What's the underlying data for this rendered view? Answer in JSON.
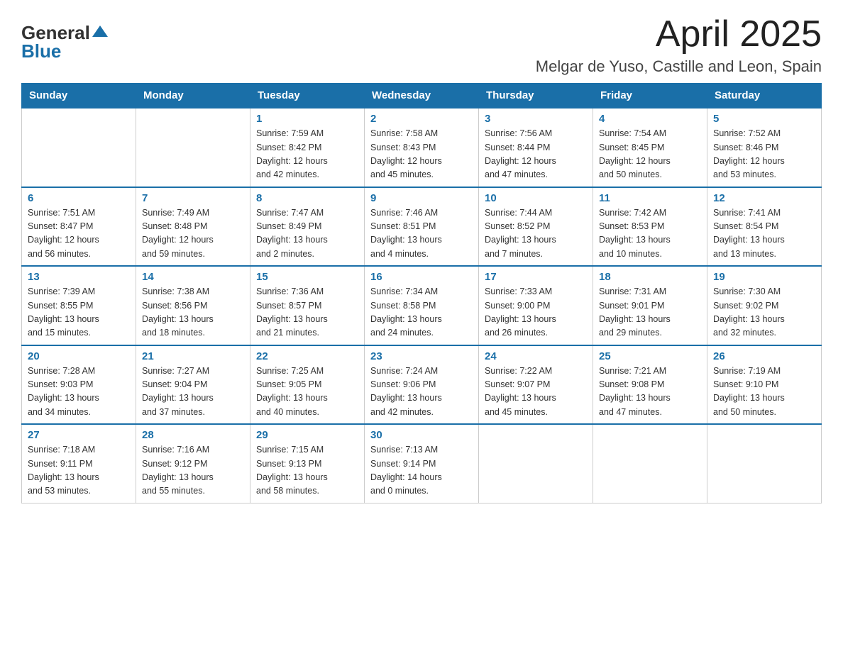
{
  "header": {
    "logo_general": "General",
    "logo_blue": "Blue",
    "title": "April 2025",
    "subtitle": "Melgar de Yuso, Castille and Leon, Spain"
  },
  "days_of_week": [
    "Sunday",
    "Monday",
    "Tuesday",
    "Wednesday",
    "Thursday",
    "Friday",
    "Saturday"
  ],
  "weeks": [
    [
      {
        "day": "",
        "info": ""
      },
      {
        "day": "",
        "info": ""
      },
      {
        "day": "1",
        "info": "Sunrise: 7:59 AM\nSunset: 8:42 PM\nDaylight: 12 hours\nand 42 minutes."
      },
      {
        "day": "2",
        "info": "Sunrise: 7:58 AM\nSunset: 8:43 PM\nDaylight: 12 hours\nand 45 minutes."
      },
      {
        "day": "3",
        "info": "Sunrise: 7:56 AM\nSunset: 8:44 PM\nDaylight: 12 hours\nand 47 minutes."
      },
      {
        "day": "4",
        "info": "Sunrise: 7:54 AM\nSunset: 8:45 PM\nDaylight: 12 hours\nand 50 minutes."
      },
      {
        "day": "5",
        "info": "Sunrise: 7:52 AM\nSunset: 8:46 PM\nDaylight: 12 hours\nand 53 minutes."
      }
    ],
    [
      {
        "day": "6",
        "info": "Sunrise: 7:51 AM\nSunset: 8:47 PM\nDaylight: 12 hours\nand 56 minutes."
      },
      {
        "day": "7",
        "info": "Sunrise: 7:49 AM\nSunset: 8:48 PM\nDaylight: 12 hours\nand 59 minutes."
      },
      {
        "day": "8",
        "info": "Sunrise: 7:47 AM\nSunset: 8:49 PM\nDaylight: 13 hours\nand 2 minutes."
      },
      {
        "day": "9",
        "info": "Sunrise: 7:46 AM\nSunset: 8:51 PM\nDaylight: 13 hours\nand 4 minutes."
      },
      {
        "day": "10",
        "info": "Sunrise: 7:44 AM\nSunset: 8:52 PM\nDaylight: 13 hours\nand 7 minutes."
      },
      {
        "day": "11",
        "info": "Sunrise: 7:42 AM\nSunset: 8:53 PM\nDaylight: 13 hours\nand 10 minutes."
      },
      {
        "day": "12",
        "info": "Sunrise: 7:41 AM\nSunset: 8:54 PM\nDaylight: 13 hours\nand 13 minutes."
      }
    ],
    [
      {
        "day": "13",
        "info": "Sunrise: 7:39 AM\nSunset: 8:55 PM\nDaylight: 13 hours\nand 15 minutes."
      },
      {
        "day": "14",
        "info": "Sunrise: 7:38 AM\nSunset: 8:56 PM\nDaylight: 13 hours\nand 18 minutes."
      },
      {
        "day": "15",
        "info": "Sunrise: 7:36 AM\nSunset: 8:57 PM\nDaylight: 13 hours\nand 21 minutes."
      },
      {
        "day": "16",
        "info": "Sunrise: 7:34 AM\nSunset: 8:58 PM\nDaylight: 13 hours\nand 24 minutes."
      },
      {
        "day": "17",
        "info": "Sunrise: 7:33 AM\nSunset: 9:00 PM\nDaylight: 13 hours\nand 26 minutes."
      },
      {
        "day": "18",
        "info": "Sunrise: 7:31 AM\nSunset: 9:01 PM\nDaylight: 13 hours\nand 29 minutes."
      },
      {
        "day": "19",
        "info": "Sunrise: 7:30 AM\nSunset: 9:02 PM\nDaylight: 13 hours\nand 32 minutes."
      }
    ],
    [
      {
        "day": "20",
        "info": "Sunrise: 7:28 AM\nSunset: 9:03 PM\nDaylight: 13 hours\nand 34 minutes."
      },
      {
        "day": "21",
        "info": "Sunrise: 7:27 AM\nSunset: 9:04 PM\nDaylight: 13 hours\nand 37 minutes."
      },
      {
        "day": "22",
        "info": "Sunrise: 7:25 AM\nSunset: 9:05 PM\nDaylight: 13 hours\nand 40 minutes."
      },
      {
        "day": "23",
        "info": "Sunrise: 7:24 AM\nSunset: 9:06 PM\nDaylight: 13 hours\nand 42 minutes."
      },
      {
        "day": "24",
        "info": "Sunrise: 7:22 AM\nSunset: 9:07 PM\nDaylight: 13 hours\nand 45 minutes."
      },
      {
        "day": "25",
        "info": "Sunrise: 7:21 AM\nSunset: 9:08 PM\nDaylight: 13 hours\nand 47 minutes."
      },
      {
        "day": "26",
        "info": "Sunrise: 7:19 AM\nSunset: 9:10 PM\nDaylight: 13 hours\nand 50 minutes."
      }
    ],
    [
      {
        "day": "27",
        "info": "Sunrise: 7:18 AM\nSunset: 9:11 PM\nDaylight: 13 hours\nand 53 minutes."
      },
      {
        "day": "28",
        "info": "Sunrise: 7:16 AM\nSunset: 9:12 PM\nDaylight: 13 hours\nand 55 minutes."
      },
      {
        "day": "29",
        "info": "Sunrise: 7:15 AM\nSunset: 9:13 PM\nDaylight: 13 hours\nand 58 minutes."
      },
      {
        "day": "30",
        "info": "Sunrise: 7:13 AM\nSunset: 9:14 PM\nDaylight: 14 hours\nand 0 minutes."
      },
      {
        "day": "",
        "info": ""
      },
      {
        "day": "",
        "info": ""
      },
      {
        "day": "",
        "info": ""
      }
    ]
  ]
}
